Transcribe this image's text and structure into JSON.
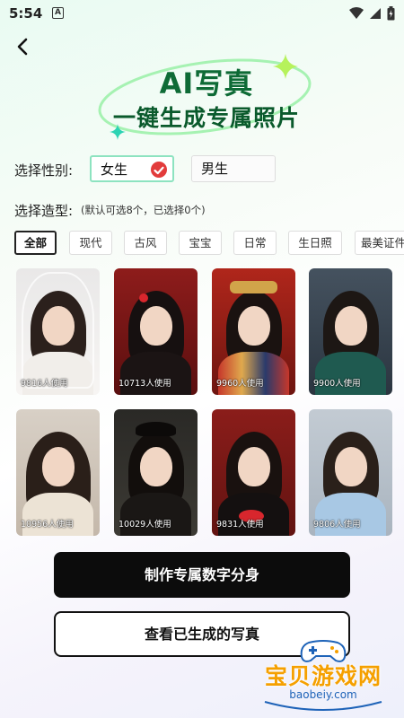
{
  "status": {
    "time": "5:54",
    "notif": "A"
  },
  "hero": {
    "title": "AI写真",
    "subtitle": "一键生成专属照片"
  },
  "gender": {
    "label": "选择性别:",
    "options": [
      {
        "label": "女生",
        "selected": true
      },
      {
        "label": "男生",
        "selected": false
      }
    ]
  },
  "style": {
    "label": "选择造型:",
    "hint": "(默认可选8个，已选择0个)",
    "tabs": [
      "全部",
      "现代",
      "古风",
      "宝宝",
      "日常",
      "生日照",
      "最美证件"
    ],
    "active_tab": "全部"
  },
  "photos": [
    {
      "count": "9816人使用"
    },
    {
      "count": "10713人使用"
    },
    {
      "count": "9960人使用"
    },
    {
      "count": "9900人使用"
    },
    {
      "count": "10956人使用"
    },
    {
      "count": "10029人使用"
    },
    {
      "count": "9831人使用"
    },
    {
      "count": "9806人使用"
    }
  ],
  "actions": {
    "primary": "制作专属数字分身",
    "secondary": "查看已生成的写真"
  },
  "watermark": {
    "text": "宝贝游戏网",
    "url": "baobeiy.com"
  },
  "colors": {
    "accent_green": "#0e6b36",
    "check_red": "#e23b3b",
    "button_black": "#0c0c0c",
    "watermark_orange": "#f5a000"
  }
}
